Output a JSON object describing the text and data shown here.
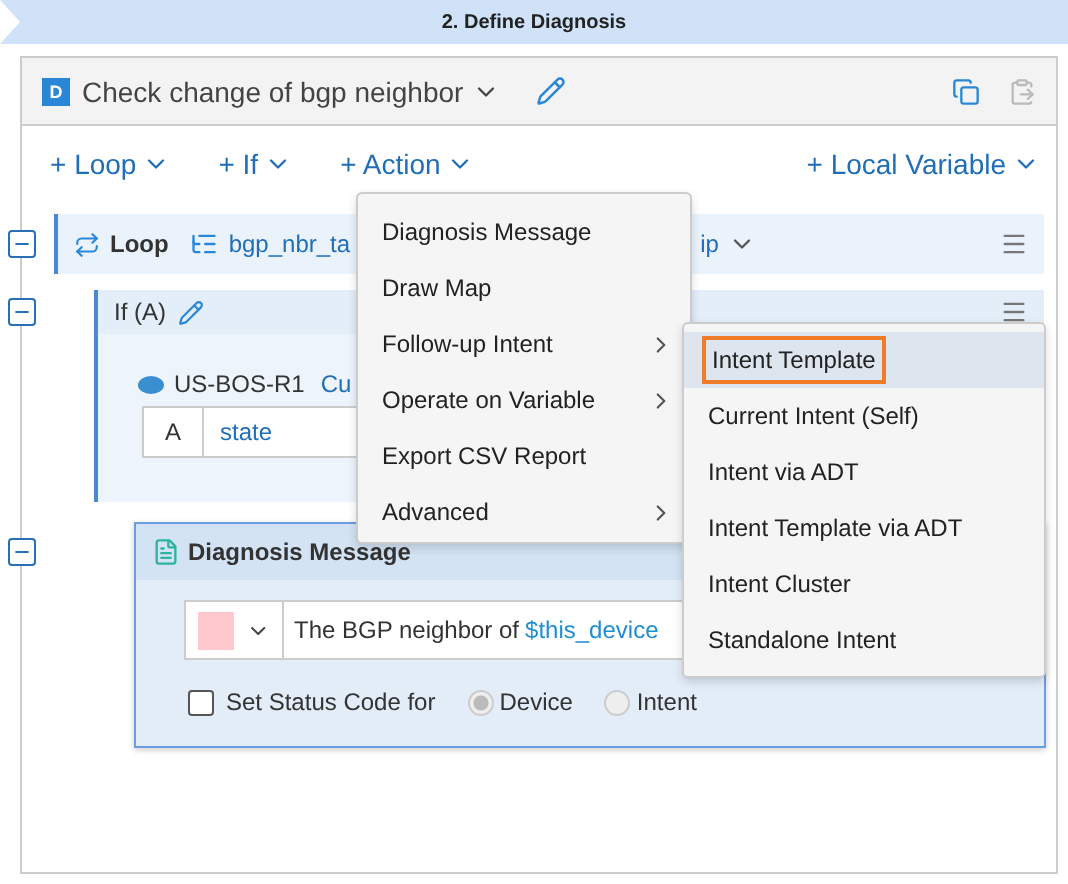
{
  "step_banner": {
    "title": "2. Define Diagnosis"
  },
  "diagnosis": {
    "badge": "D",
    "title": "Check change of bgp neighbor"
  },
  "toolbar": {
    "left": [
      "+ Loop",
      "+ If",
      "+ Action"
    ],
    "right": "+ Local Variable"
  },
  "loop": {
    "label": "Loop",
    "expanded": true,
    "table": "bgp_nbr_ta",
    "table_tail": "ip"
  },
  "if_block": {
    "label": "If (A)",
    "expanded": true,
    "device": "US-BOS-R1",
    "device_tail": "Cu",
    "conditions": [
      {
        "name": "A",
        "value": "state"
      }
    ]
  },
  "message": {
    "title": "Diagnosis Message",
    "expanded": true,
    "color": "#ffc7ce",
    "text": "The BGP neighbor of",
    "variable": "$this_device",
    "status_code": {
      "label": "Set Status Code for",
      "checked": false,
      "options": [
        {
          "label": "Device",
          "selected": true
        },
        {
          "label": "Intent",
          "selected": false
        }
      ]
    }
  },
  "action_menu": [
    {
      "label": "Diagnosis Message",
      "has_submenu": false
    },
    {
      "label": "Draw Map",
      "has_submenu": false
    },
    {
      "label": "Follow-up Intent",
      "has_submenu": true
    },
    {
      "label": "Operate on Variable",
      "has_submenu": true
    },
    {
      "label": "Export CSV Report",
      "has_submenu": false
    },
    {
      "label": "Advanced",
      "has_submenu": true
    }
  ],
  "followup_menu": [
    {
      "label": "Intent Template",
      "selected": true
    },
    {
      "label": "Current Intent (Self)",
      "selected": false
    },
    {
      "label": "Intent via ADT",
      "selected": false
    },
    {
      "label": "Intent Template via ADT",
      "selected": false
    },
    {
      "label": "Intent Cluster",
      "selected": false
    },
    {
      "label": "Standalone Intent",
      "selected": false
    }
  ]
}
